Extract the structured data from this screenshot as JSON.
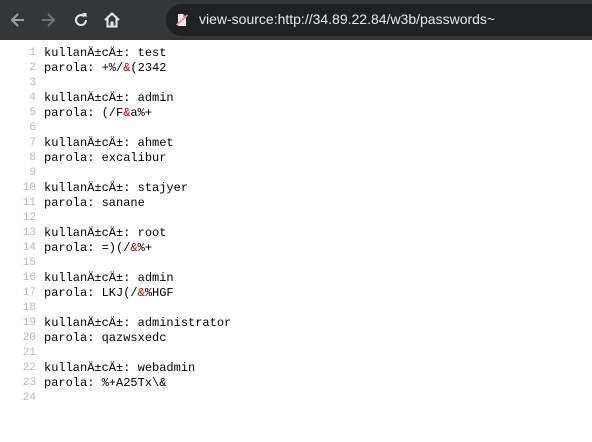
{
  "browser": {
    "back_icon": "arrow-left-icon",
    "forward_icon": "arrow-right-icon",
    "reload_icon": "reload-icon",
    "home_icon": "home-icon",
    "security_icon": "not-secure-icon",
    "url": "view-source:http://34.89.22.84/w3b/passwords~"
  },
  "source": {
    "lines": [
      {
        "num": "1",
        "parts": [
          {
            "t": "kullanÄ±cÄ±: test",
            "e": false
          }
        ]
      },
      {
        "num": "2",
        "parts": [
          {
            "t": "parola: +%/",
            "e": false
          },
          {
            "t": "&",
            "e": true
          },
          {
            "t": "(2342",
            "e": false
          }
        ]
      },
      {
        "num": "3",
        "parts": []
      },
      {
        "num": "4",
        "parts": [
          {
            "t": "kullanÄ±cÄ±: admin",
            "e": false
          }
        ]
      },
      {
        "num": "5",
        "parts": [
          {
            "t": "parola: (/F",
            "e": false
          },
          {
            "t": "&",
            "e": true
          },
          {
            "t": "a%+",
            "e": false
          }
        ]
      },
      {
        "num": "6",
        "parts": []
      },
      {
        "num": "7",
        "parts": [
          {
            "t": "kullanÄ±cÄ±: ahmet",
            "e": false
          }
        ]
      },
      {
        "num": "8",
        "parts": [
          {
            "t": "parola: excalibur",
            "e": false
          }
        ]
      },
      {
        "num": "9",
        "parts": []
      },
      {
        "num": "10",
        "parts": [
          {
            "t": "kullanÄ±cÄ±: stajyer",
            "e": false
          }
        ]
      },
      {
        "num": "11",
        "parts": [
          {
            "t": "parola: sanane",
            "e": false
          }
        ]
      },
      {
        "num": "12",
        "parts": []
      },
      {
        "num": "13",
        "parts": [
          {
            "t": "kullanÄ±cÄ±: root",
            "e": false
          }
        ]
      },
      {
        "num": "14",
        "parts": [
          {
            "t": "parola: =)(/",
            "e": false
          },
          {
            "t": "&",
            "e": true
          },
          {
            "t": "%+",
            "e": false
          }
        ]
      },
      {
        "num": "15",
        "parts": []
      },
      {
        "num": "16",
        "parts": [
          {
            "t": "kullanÄ±cÄ±: admin",
            "e": false
          }
        ]
      },
      {
        "num": "17",
        "parts": [
          {
            "t": "parola: LKJ(/",
            "e": false
          },
          {
            "t": "&",
            "e": true
          },
          {
            "t": "%HGF",
            "e": false
          }
        ]
      },
      {
        "num": "18",
        "parts": []
      },
      {
        "num": "19",
        "parts": [
          {
            "t": "kullanÄ±cÄ±: administrator",
            "e": false
          }
        ]
      },
      {
        "num": "20",
        "parts": [
          {
            "t": "parola: qazwsxedc",
            "e": false
          }
        ]
      },
      {
        "num": "21",
        "parts": []
      },
      {
        "num": "22",
        "parts": [
          {
            "t": "kullanÄ±cÄ±: webadmin",
            "e": false
          }
        ]
      },
      {
        "num": "23",
        "parts": [
          {
            "t": "parola: %+A25Tx\\&",
            "e": false
          }
        ]
      },
      {
        "num": "24",
        "parts": []
      }
    ]
  }
}
